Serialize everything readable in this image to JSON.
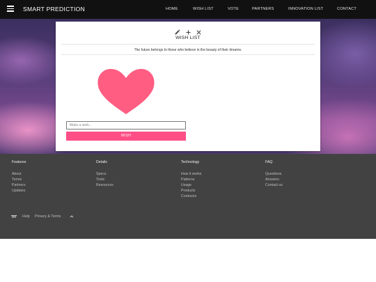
{
  "navbar": {
    "brand": "SMART PREDICTION",
    "links": [
      "HOME",
      "WISH LIST",
      "VOTE",
      "PARTNERS",
      "INNOVATION LIST",
      "CONTACT"
    ]
  },
  "card": {
    "title": "WISH LIST",
    "tagline": "The future belongs to those who believe in the beauty of their dreams.",
    "input_placeholder": "Make a wish...",
    "button_label": "WISH"
  },
  "footer": {
    "columns": [
      {
        "heading": "Features",
        "links": [
          "About",
          "Terms",
          "Partners",
          "Updates"
        ]
      },
      {
        "heading": "Details",
        "links": [
          "Specs",
          "Tools",
          "Resources"
        ]
      },
      {
        "heading": "Technology",
        "links": [
          "How it works",
          "Patterns",
          "Usage",
          "Products",
          "Contracts"
        ]
      },
      {
        "heading": "FAQ",
        "links": [
          "Questions",
          "Answers",
          "Contact us"
        ]
      }
    ],
    "bottom_links": [
      "Help",
      "Privacy & Terms"
    ]
  },
  "colors": {
    "navbar": "#111111",
    "accent_pink": "#ff4f86",
    "heart": "#ff5d82",
    "footer": "#424242"
  },
  "icons": {
    "menu": "hamburger-menu-icon",
    "edit": "pencil-icon",
    "add": "plus-icon",
    "close": "close-icon",
    "footer_logo": "logo-icon",
    "back_to_top": "chevron-up-icon"
  }
}
